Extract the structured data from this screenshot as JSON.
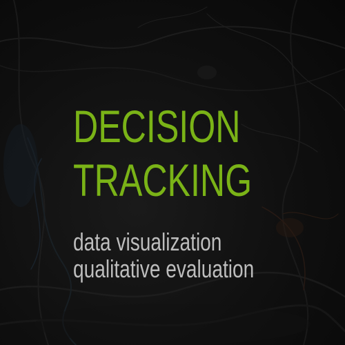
{
  "title": {
    "line1": "DECISION",
    "line2": "TRACKING"
  },
  "subtitle": {
    "line1": "data visualization",
    "line2": "qualitative evaluation"
  },
  "colors": {
    "accent": "#7ab317",
    "subtitle": "#bdbdbd",
    "background": "#0c0c0c"
  }
}
